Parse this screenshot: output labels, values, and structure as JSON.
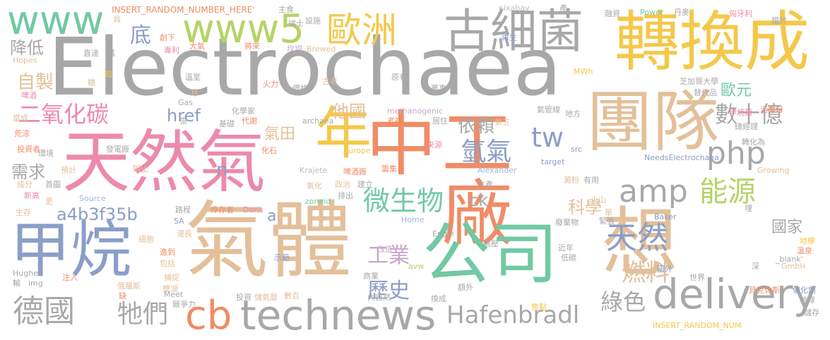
{
  "big": {
    "electrochaea": "Electrochaea",
    "tianranqi": "天然氣",
    "qiti": "氣體",
    "zhonggongchang": "中工廠",
    "tuandui": "團隊",
    "zhuanhuancheng": "轉換成",
    "jiawan": "甲烷",
    "gongsi": "公司",
    "xiang": "想",
    "nian": "年",
    "guxijun": "古細菌",
    "ouzhou": "歐洲",
    "www": "www",
    "www5": "www5",
    "technews": "technews",
    "delivery": "delivery",
    "php": "php",
    "amp": "amp",
    "tw": "tw",
    "cb": "cb",
    "hafenbradl": "Hafenbradl"
  },
  "mid": {
    "eryanghuatan": "二氧化碳",
    "deguo": "德國",
    "weishengwu": "微生物",
    "nengyuan": "能源",
    "tianran": "天然",
    "shushiyi": "數十億",
    "ouyuan": "歐元",
    "qingqi": "氫氣",
    "ranliao": "燃料",
    "lvse": "綠色",
    "lishi": "歷史",
    "gongye": "工業",
    "tamen": "牠們",
    "a4b": "a4b3f35b",
    "zizhi": "自製",
    "xuqiu": "需求",
    "jiangdi": "降低",
    "di": "底",
    "yilai": "依賴",
    "taguo": "他國",
    "qitian": "氣田",
    "href": "href",
    "kexue": "科學",
    "guojia": "國家",
    "ck": "ck",
    "n": "n",
    "a": "a"
  },
  "small": [
    "INSERT_RANDOM_NUMBER_HERE'",
    "主食",
    "pixabay",
    "產",
    "融資",
    "Power",
    "丹麥",
    "匈牙利",
    "趨於",
    "具",
    "瑞士",
    "設施",
    "再生",
    "創下",
    "專利",
    "大氣",
    "將來",
    "坎坷",
    "Brewed",
    "直達",
    "萬",
    "Hopes",
    "知",
    "糖",
    "溫室",
    "火力",
    "價格",
    "古老",
    "原有",
    "MWh",
    "芝加哥大學",
    "董事",
    "替代品",
    "啤酒",
    "月",
    "Gas",
    "化學家",
    "methanogenic",
    "氣管線",
    "甲烷菌",
    "活酵母",
    "當成",
    "億",
    "基礎",
    "代謝",
    "archaea",
    "老祖",
    "居住",
    "第五",
    "地方",
    "總經理",
    "荒涼",
    "發電廠",
    "化石",
    "Europe",
    "來源",
    "轉化為",
    "src",
    "投資者",
    "環境",
    "預計",
    "阻止",
    "Krajete",
    "啤酒廠",
    "籌集",
    "Alexander",
    "target",
    "NeedsElectrochaea",
    "Growing",
    "成分",
    "首圖",
    "新高",
    "氧化",
    "政治",
    "排出",
    "建立",
    "生產",
    "澱粉",
    "有用",
    "更",
    "Source",
    "zoneid",
    "生存",
    "路程",
    "倖存者",
    "Doris",
    "Baker",
    "火山",
    "單",
    "埋",
    "緊張",
    "SA",
    "Home",
    "廢棄物",
    "漫長",
    "細胞",
    "Engie",
    "進到",
    "改造",
    "高壓",
    "近年",
    "地橡",
    "溫泉",
    "示範",
    "低碳",
    "_blank'",
    "Hughes",
    "包括",
    "捕捉",
    "avw",
    "國外",
    "深",
    "GmbH",
    "注入",
    "商業",
    "世界",
    "輸",
    "img",
    "俄羅斯",
    "鹽湖",
    "額外",
    "貝克休斯",
    "催化劑",
    "缺",
    "Meet",
    "數百",
    "地球",
    "競爭力",
    "投資",
    "儲氣層",
    "大自然",
    "換成",
    "焦點",
    "INSERT_RANDOM_NUM",
    "儲存"
  ]
}
